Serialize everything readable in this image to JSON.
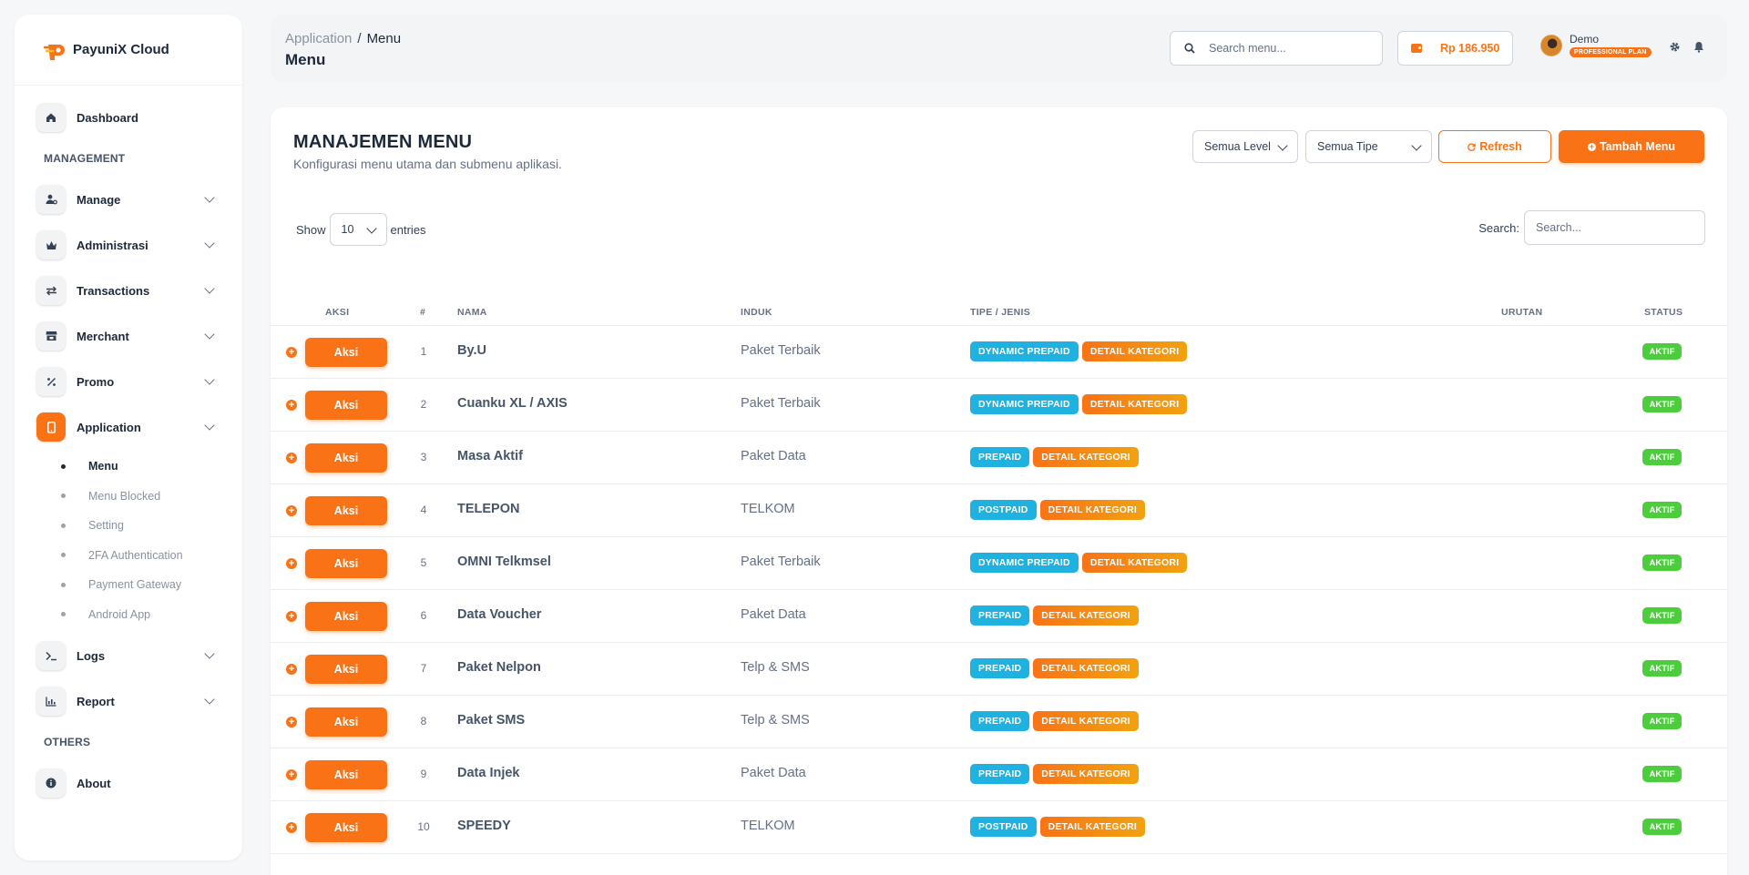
{
  "brand": {
    "name": "PayuniX Cloud"
  },
  "sidebar": {
    "dashboard": "Dashboard",
    "section_management": "MANAGEMENT",
    "manage": "Manage",
    "administrasi": "Administrasi",
    "transactions": "Transactions",
    "merchant": "Merchant",
    "promo": "Promo",
    "application": "Application",
    "application_sub": [
      "Menu",
      "Menu Blocked",
      "Setting",
      "2FA Authentication",
      "Payment Gateway",
      "Android App"
    ],
    "logs": "Logs",
    "report": "Report",
    "section_others": "OTHERS",
    "about": "About"
  },
  "header": {
    "breadcrumb_parent": "Application",
    "breadcrumb_sep": "/",
    "breadcrumb_current": "Menu",
    "title": "Menu",
    "search_placeholder": "Search menu...",
    "balance": "Rp 186.950",
    "user_name": "Demo",
    "plan": "PROFESSIONAL PLAN"
  },
  "card": {
    "title": "MANAJEMEN MENU",
    "subtitle": "Konfigurasi menu utama dan submenu aplikasi.",
    "filter_level": "Semua Level",
    "filter_type": "Semua Tipe",
    "refresh_label": "Refresh",
    "add_label": "Tambah Menu",
    "show_label": "Show",
    "entries_value": "10",
    "entries_label": "entries",
    "search_label": "Search:",
    "search_placeholder": "Search..."
  },
  "table": {
    "columns": {
      "aksi": "AKSI",
      "num": "#",
      "nama": "NAMA",
      "induk": "INDUK",
      "tipe": "TIPE / JENIS",
      "urutan": "URUTAN",
      "status": "STATUS"
    },
    "action_label": "Aksi",
    "status_label": "AKTIF",
    "detail_label": "DETAIL KATEGORI",
    "rows": [
      {
        "num": "1",
        "nama": "By.U",
        "induk": "Paket Terbaik",
        "tipe": "DYNAMIC PREPAID"
      },
      {
        "num": "2",
        "nama": "Cuanku XL / AXIS",
        "induk": "Paket Terbaik",
        "tipe": "DYNAMIC PREPAID"
      },
      {
        "num": "3",
        "nama": "Masa Aktif",
        "induk": "Paket Data",
        "tipe": "PREPAID"
      },
      {
        "num": "4",
        "nama": "TELEPON",
        "induk": "TELKOM",
        "tipe": "POSTPAID"
      },
      {
        "num": "5",
        "nama": "OMNI Telkmsel",
        "induk": "Paket Terbaik",
        "tipe": "DYNAMIC PREPAID"
      },
      {
        "num": "6",
        "nama": "Data Voucher",
        "induk": "Paket Data",
        "tipe": "PREPAID"
      },
      {
        "num": "7",
        "nama": "Paket Nelpon",
        "induk": "Telp & SMS",
        "tipe": "PREPAID"
      },
      {
        "num": "8",
        "nama": "Paket SMS",
        "induk": "Telp & SMS",
        "tipe": "PREPAID"
      },
      {
        "num": "9",
        "nama": "Data Injek",
        "induk": "Paket Data",
        "tipe": "PREPAID"
      },
      {
        "num": "10",
        "nama": "SPEEDY",
        "induk": "TELKOM",
        "tipe": "POSTPAID"
      }
    ]
  },
  "colors": {
    "accent": "#f97316",
    "tag_blue": "#1fb1e0",
    "status_green": "#4ccd3c"
  }
}
